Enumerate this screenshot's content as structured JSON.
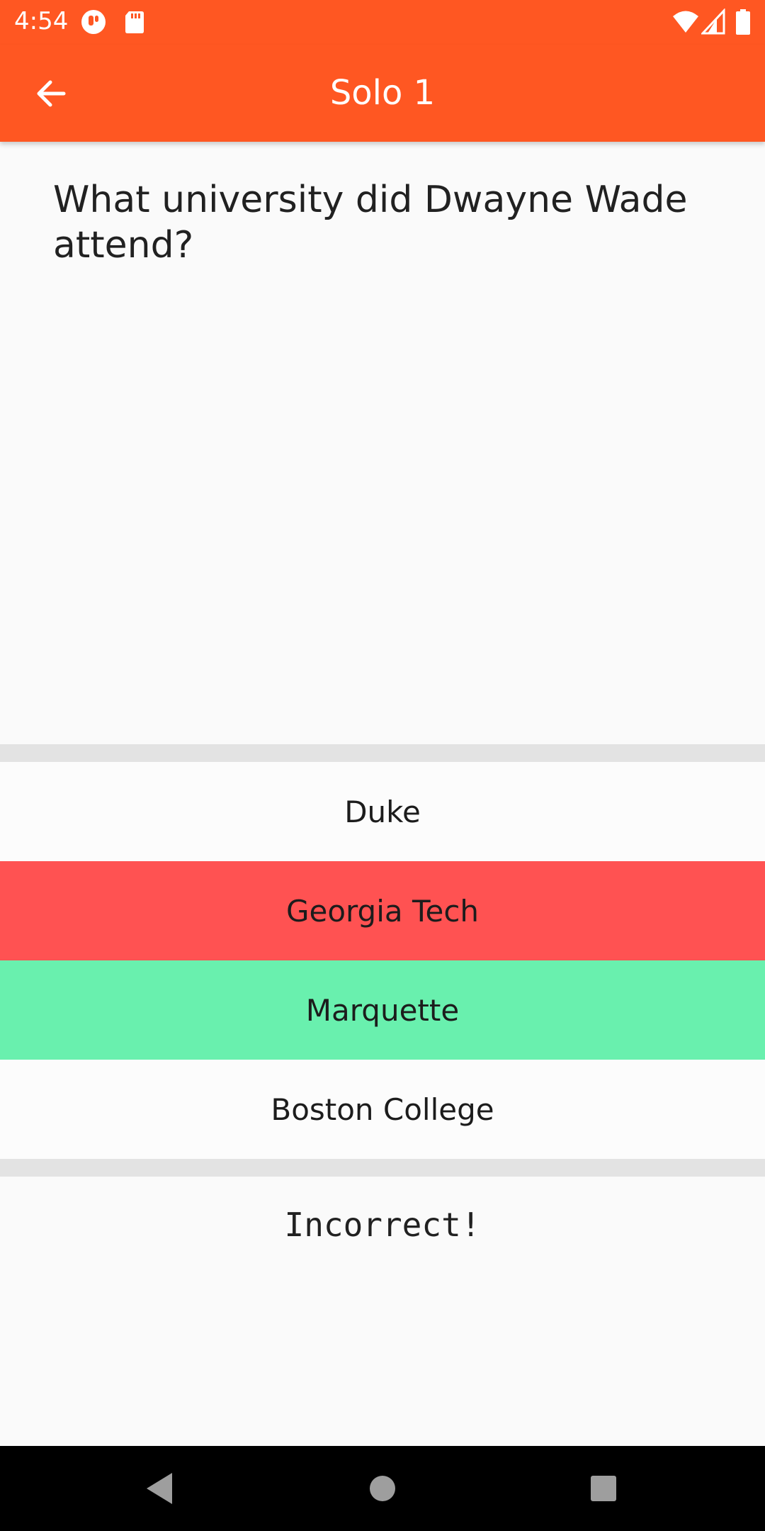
{
  "status_bar": {
    "time": "4:54",
    "icons_left": [
      "app-notification-icon",
      "sd-card-icon"
    ],
    "icons_right": [
      "wifi-icon",
      "cell-signal-icon",
      "battery-icon"
    ]
  },
  "app_bar": {
    "title": "Solo 1",
    "back_icon": "arrow-back-icon",
    "color": "#ff5722"
  },
  "question": {
    "text": "What university did Dwayne Wade attend?"
  },
  "answers": [
    {
      "label": "Duke",
      "state": "neutral"
    },
    {
      "label": "Georgia Tech",
      "state": "wrong",
      "color": "#ff5252"
    },
    {
      "label": "Marquette",
      "state": "right",
      "color": "#69f0ae"
    },
    {
      "label": "Boston College",
      "state": "neutral"
    }
  ],
  "result": {
    "text": "Incorrect!"
  },
  "nav_bar": {
    "buttons": [
      "back-triangle-icon",
      "home-circle-icon",
      "recents-square-icon"
    ]
  }
}
